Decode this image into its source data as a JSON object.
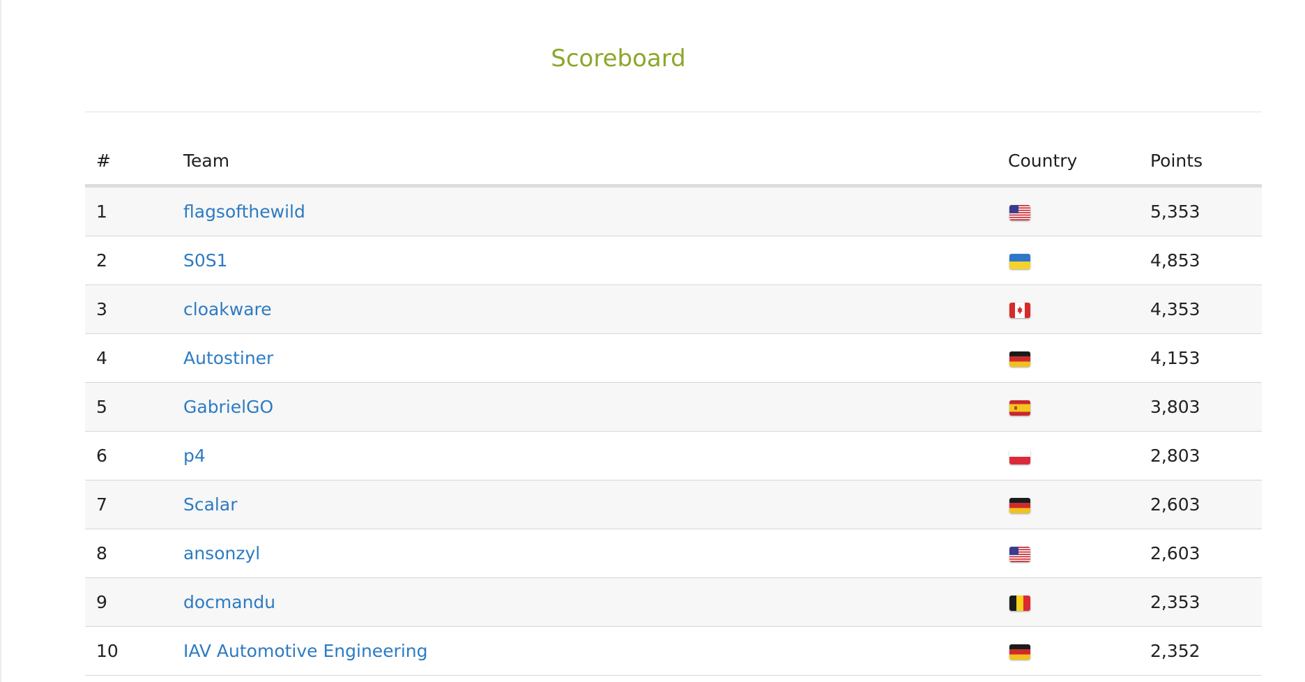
{
  "page": {
    "title": "Scoreboard",
    "title_color": "#8aa82a",
    "link_color": "#2d7bc2"
  },
  "table": {
    "headers": {
      "rank": "#",
      "team": "Team",
      "country": "Country",
      "points": "Points"
    },
    "rows": [
      {
        "rank": "1",
        "team": "flagsofthewild",
        "country": "us-flag-icon",
        "points": "5,353"
      },
      {
        "rank": "2",
        "team": "S0S1",
        "country": "ua-flag-icon",
        "points": "4,853"
      },
      {
        "rank": "3",
        "team": "cloakware",
        "country": "ca-flag-icon",
        "points": "4,353"
      },
      {
        "rank": "4",
        "team": "Autostiner",
        "country": "de-flag-icon",
        "points": "4,153"
      },
      {
        "rank": "5",
        "team": "GabrielGO",
        "country": "es-flag-icon",
        "points": "3,803"
      },
      {
        "rank": "6",
        "team": "p4",
        "country": "pl-flag-icon",
        "points": "2,803"
      },
      {
        "rank": "7",
        "team": "Scalar",
        "country": "de-flag-icon",
        "points": "2,603"
      },
      {
        "rank": "8",
        "team": "ansonzyl",
        "country": "us-flag-icon",
        "points": "2,603"
      },
      {
        "rank": "9",
        "team": "docmandu",
        "country": "be-flag-icon",
        "points": "2,353"
      },
      {
        "rank": "10",
        "team": "IAV Automotive Engineering",
        "country": "de-flag-icon",
        "points": "2,352"
      }
    ]
  }
}
